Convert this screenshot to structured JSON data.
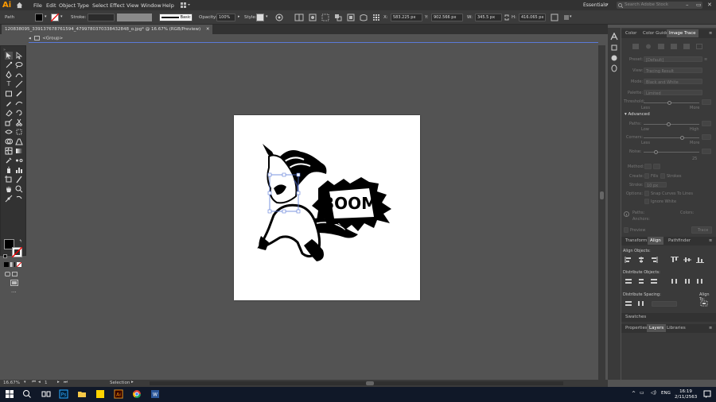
{
  "app": {
    "logo": "Ai",
    "workspace": "Essentials",
    "search_placeholder": "Search Adobe Stock"
  },
  "menu": [
    "File",
    "Edit",
    "Object",
    "Type",
    "Select",
    "Effect",
    "View",
    "Window",
    "Help"
  ],
  "control": {
    "object_type": "Path",
    "stroke_label": "Stroke:",
    "brush": "Basic",
    "opacity_label": "Opacity:",
    "opacity": "100%",
    "style_label": "Style:",
    "x_label": "X:",
    "x": "583.225 px",
    "y_label": "Y:",
    "y": "902.566 px",
    "w_label": "W:",
    "w": "345.5 px",
    "h_label": "H:",
    "h": "416.065 px"
  },
  "document": {
    "tab": "120838095_339137678761594_4799780370338432848_o.jpg* @ 16.67% (RGB/Preview)",
    "breadcrumb": "<Group>"
  },
  "status": {
    "zoom": "16.67%",
    "page": "1",
    "tool": "Selection"
  },
  "colors": {
    "brand": "#ff9a00",
    "accent": "#5a7ad8",
    "artboard": "#ffffff"
  },
  "image_trace": {
    "tabs": [
      "Color",
      "Color Guide",
      "Image Trace"
    ],
    "active_tab": "Image Trace",
    "preset_label": "Preset:",
    "preset": "[Default]",
    "view_label": "View:",
    "view": "Tracing Result",
    "mode_label": "Mode:",
    "mode": "Black and White",
    "palette_label": "Palette:",
    "palette": "Limited",
    "threshold_label": "Threshold:",
    "less": "Less",
    "more": "More",
    "advanced": "Advanced",
    "paths_label": "Paths:",
    "low": "Low",
    "high": "High",
    "corners_label": "Corners:",
    "noise_label": "Noise:",
    "noise_val": "25",
    "method_label": "Method:",
    "create_label": "Create:",
    "fills": "Fills",
    "strokes": "Strokes",
    "stroke_label": "Stroke:",
    "stroke_val": "10 px",
    "options_label": "Options:",
    "snap": "Snap Curves To Lines",
    "ignore_white": "Ignore White",
    "paths_info": "Paths:",
    "colors_info": "Colors:",
    "anchors_info": "Anchors:",
    "preview": "Preview",
    "trace": "Trace"
  },
  "align": {
    "tabs": [
      "Transform",
      "Align",
      "Pathfinder"
    ],
    "active_tab": "Align",
    "align_objects": "Align Objects:",
    "distribute_objects": "Distribute Objects:",
    "distribute_spacing": "Distribute Spacing:",
    "align_to": "Align To:"
  },
  "swatches": {
    "title": "Swatches"
  },
  "layers": {
    "tabs": [
      "Properties",
      "Layers",
      "Libraries"
    ],
    "active_tab": "Layers"
  },
  "artwork": {
    "text": "BOOM!"
  },
  "taskbar": {
    "time": "16:19",
    "date": "2/11/2563",
    "lang": "ENG"
  }
}
